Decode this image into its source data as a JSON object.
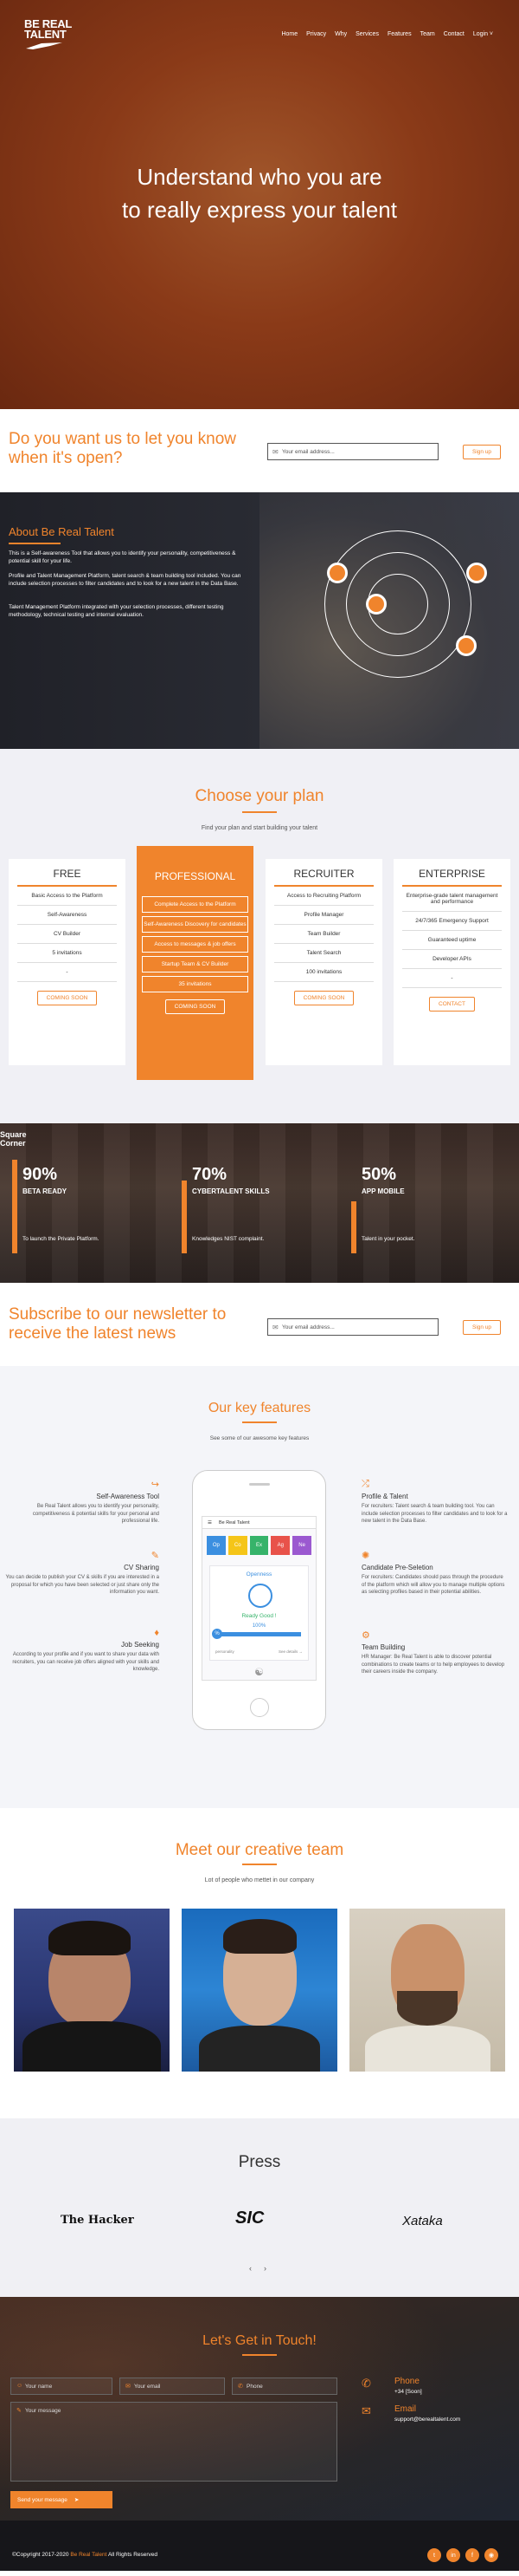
{
  "hero": {
    "logo_line1": "BE REAL",
    "logo_line2": "TALENT",
    "nav": [
      "Home",
      "Privacy",
      "Why",
      "Services",
      "Features",
      "Team",
      "Contact",
      "Login ˅"
    ],
    "headline_1": "Understand who you are",
    "headline_2": "to really express your talent"
  },
  "notify": {
    "title": "Do you want us to let you know when it's open?",
    "placeholder": "Your email address...",
    "button": "Sign up"
  },
  "about": {
    "title": "About Be Real Talent",
    "p1": "This is a Self-awareness Tool that allows you to identify your personality, competitiveness & potential skill for your life.",
    "p2": "Profile and Talent Management Platform, talent search & team building tool included. You can include selection processes to filter candidates and to look for a new talent in the Data Base.",
    "p3": "Talent Management Platform integrated with your selection processes, different testing methodology, technical testing and internal evaluation."
  },
  "plans": {
    "title": "Choose your plan",
    "subtitle": "Find your plan and start building your talent",
    "items": [
      {
        "name": "FREE",
        "features": [
          "Basic Access to the Platform",
          "Self-Awareness",
          "CV Builder",
          "5 invitations",
          "-"
        ],
        "button": "COMING SOON"
      },
      {
        "name": "PROFESSIONAL",
        "features": [
          "Complete Access to the Platform",
          "Self-Awareness Discovery for candidates",
          "Access to messages & job offers",
          "Startup Team & CV Builder",
          "35 invitations"
        ],
        "button": "COMING SOON"
      },
      {
        "name": "RECRUITER",
        "features": [
          "Access to Recruiting Platform",
          "Profile Manager",
          "Team Builder",
          "Talent Search",
          "100 invitations"
        ],
        "button": "COMING SOON"
      },
      {
        "name": "ENTERPRISE",
        "features": [
          "Enterprise-grade talent management and performance",
          "24/7/365 Emergency Support",
          "Guaranteed uptime",
          "Developer APIs",
          "-"
        ],
        "button": "CONTACT"
      }
    ]
  },
  "stats": {
    "corner_1": "Square",
    "corner_2": "Corner",
    "items": [
      {
        "value": "90%",
        "label": "BETA READY",
        "desc": "To launch the Private Platform.",
        "fill": 0.9
      },
      {
        "value": "70%",
        "label": "CYBERTALENT SKILLS",
        "desc": "Knowledges NIST complaint.",
        "fill": 0.7
      },
      {
        "value": "50%",
        "label": "APP MOBILE",
        "desc": "Talent in your pocket.",
        "fill": 0.5
      }
    ]
  },
  "newsletter": {
    "title": "Subscribe to our newsletter to receive the latest news",
    "placeholder": "Your email address...",
    "button": "Sign up"
  },
  "features": {
    "title": "Our key features",
    "subtitle": "See some of our awesome key features",
    "left": [
      {
        "icon": "share-icon",
        "title": "Self-Awareness Tool",
        "desc": "Be Real Talent allows you to identify your personality, competitiveness & potential skills for your personal and professional life."
      },
      {
        "icon": "edit-icon",
        "title": "CV Sharing",
        "desc": "You can decide to publish your CV & skills if you are interested in a proposal for which you have been selected or just share only the information you want."
      },
      {
        "icon": "tag-icon",
        "title": "Job Seeking",
        "desc": "According to your profile and if you want to share your data with recruiters, you can receive job offers aligned with your skills and knowledge."
      }
    ],
    "right": [
      {
        "icon": "shuffle-icon",
        "title": "Profile & Talent",
        "desc": "For recruiters: Talent search & team building tool. You can include selection processes to filter candidates and to look for a new talent in the Data Base."
      },
      {
        "icon": "gear-icon",
        "title": "Candidate Pre-Seletion",
        "desc": "For recruiters: Candidates should pass through the procedure of the platform which will allow you to manage multiple options as selecting profiles based in their potential abilities."
      },
      {
        "icon": "settings-icon",
        "title": "Team Building",
        "desc": "HR Manager: Be Real Talent is able to discover potential combinations to create teams or to help employees to develop their careers inside the company."
      }
    ],
    "phone": {
      "app_title": "Be Real Talent",
      "tiles": [
        "Op",
        "Co",
        "Ex",
        "Ag",
        "Ne"
      ],
      "tile_colors": [
        "#3b8fe0",
        "#f5c518",
        "#36b36a",
        "#e8524a",
        "#9b59d0"
      ],
      "openness": "Openness",
      "ready": "Ready Good !",
      "percent": "100%",
      "progress": 1.0,
      "left_link": "personality",
      "right_link": "See details →"
    }
  },
  "team": {
    "title": "Meet our creative team",
    "subtitle": "Lot of people who mettet in our company"
  },
  "press": {
    "title": "Press",
    "logos": [
      "The Hacker",
      "SIC",
      "Xataka"
    ],
    "prev": "‹",
    "next": "›"
  },
  "contact": {
    "title": "Let's Get in Touch!",
    "name_ph": "Your name",
    "email_ph": "Your email",
    "phone_ph": "Phone",
    "message_ph": "Your message",
    "send": "Send your message",
    "phone_label": "Phone",
    "phone_value": "+34 [Soon]",
    "email_label": "Email",
    "email_value": "support@berealtalent.com"
  },
  "footer": {
    "copy_1": "©Copyright 2017-2020",
    "copy_brand": "Be Real Talent",
    "copy_2": "All Rights Reserved",
    "social": [
      "twitter-icon",
      "linkedin-icon",
      "facebook-icon",
      "instagram-icon"
    ]
  },
  "colors": {
    "accent": "#f0842c",
    "dark": "#1f2028"
  }
}
